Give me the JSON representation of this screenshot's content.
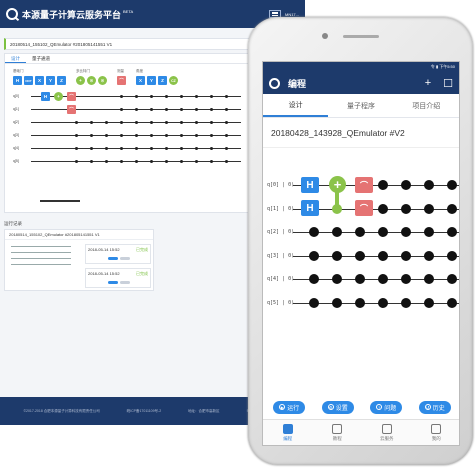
{
  "desktop": {
    "brand": "本源量子计算云服务平台",
    "beta": "BETA",
    "user_label": "MN17...",
    "file_title": "20180514_155102_QEmulator #201805141551 V1",
    "tabs": [
      "设计",
      "量子通道"
    ],
    "gate_groups": [
      {
        "label": "基础门",
        "gates": [
          "H",
          "NOT",
          "X",
          "Y",
          "Z"
        ]
      },
      {
        "label": "多比特门",
        "gates": [
          "+",
          "⊙",
          "⊙"
        ]
      },
      {
        "label": "测量",
        "gates": [
          "⌒"
        ]
      },
      {
        "label": "角度",
        "gates": [
          "X",
          "Y",
          "Z",
          "CZ"
        ]
      }
    ],
    "qubits": [
      "q[0]",
      "q[1]",
      "q[2]",
      "q[3]",
      "q[4]",
      "q[5]"
    ],
    "record_title": "运行记录",
    "record_head": "20180514_155102_QEmulator #201805141551 V1",
    "records": [
      {
        "time": "2018-05-14 15:52",
        "status": "已完成"
      },
      {
        "time": "2018-05-14 15:52",
        "status": "已完成"
      }
    ],
    "footer_items": [
      "©2017-2018 合肥本源量子计算科技有限责任公司",
      "皖ICP备17011109号-2",
      "地址：合肥市高新区",
      "电话：0551-63836038"
    ]
  },
  "phone": {
    "status_text": "令 ▮ 下午5:50",
    "app_title": "编程",
    "actions": [
      "+",
      "☐"
    ],
    "tabs": [
      "设计",
      "量子程序",
      "项目介绍"
    ],
    "file_title": "20180428_143928_QEmulator #V2",
    "qubits": [
      "q[0] | 0⟩",
      "q[1] | 0⟩",
      "q[2] | 0⟩",
      "q[3] | 0⟩",
      "q[4] | 0⟩",
      "q[5] | 0⟩"
    ],
    "gate_H": "H",
    "gate_CNOT": "+",
    "gate_measure": "⌒",
    "buttons": [
      {
        "label": "运行",
        "icon": "play-icon"
      },
      {
        "label": "设置",
        "icon": "gear-icon"
      },
      {
        "label": "问题",
        "icon": "question-icon"
      },
      {
        "label": "历史",
        "icon": "history-icon"
      }
    ],
    "nav": [
      "编程",
      "教程",
      "云服务",
      "我的"
    ]
  },
  "colors": {
    "navy": "#1d3a6b",
    "gate_blue": "#2e8ae6",
    "gate_green": "#8bc34a",
    "gate_red": "#e57373"
  }
}
